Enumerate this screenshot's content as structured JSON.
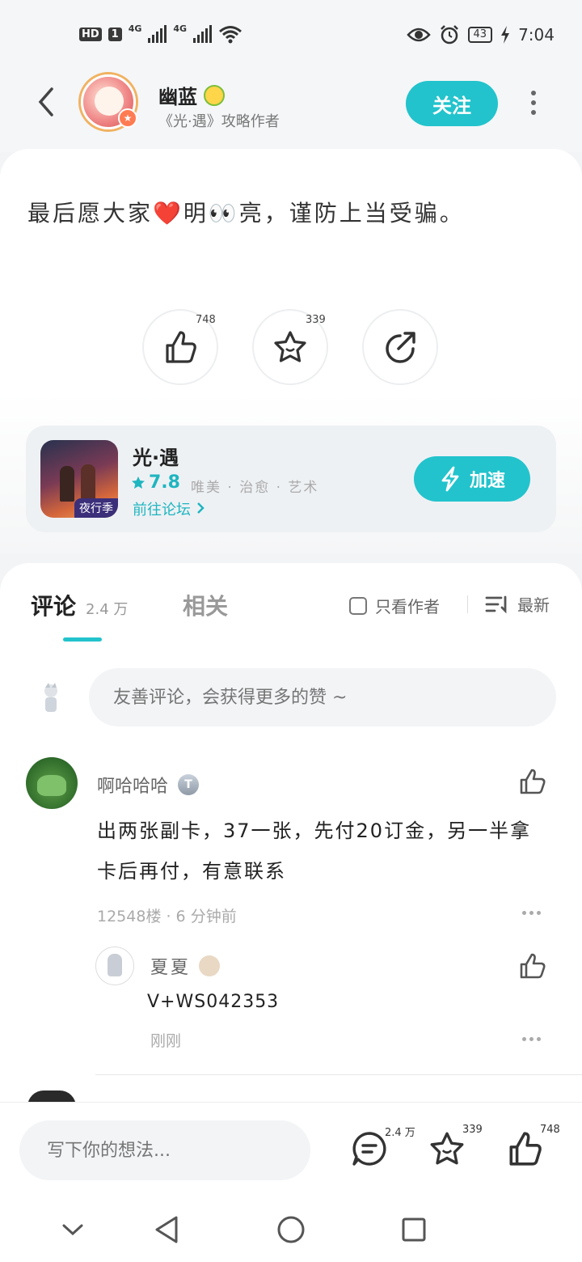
{
  "status_bar": {
    "hd": "HD",
    "sim": "1",
    "net1": "4G",
    "net2": "4G",
    "battery": "43",
    "time": "7:04"
  },
  "header": {
    "author_name": "幽蓝",
    "author_subtitle": "《光·遇》攻略作者",
    "follow_label": "关注"
  },
  "post": {
    "text": "最后愿大家❤️明👀亮，谨防上当受骗。",
    "like_count": "748",
    "favorite_count": "339"
  },
  "game_card": {
    "name": "光·遇",
    "rating": "7.8",
    "tags": "唯美 · 治愈 · 艺术",
    "icon_tag": "夜行季",
    "forum_link": "前往论坛",
    "boost_label": "加速"
  },
  "comments": {
    "tab_label": "评论",
    "tab_count": "2.4 万",
    "related_label": "相关",
    "author_only_label": "只看作者",
    "sort_label": "最新",
    "input_placeholder": "友善评论，会获得更多的赞 ~",
    "items": [
      {
        "user": "啊哈哈哈",
        "level_badge": "T",
        "text": "出两张副卡，37一张，先付20订金，另一半拿卡后再付，有意联系",
        "meta": "12548楼 · 6 分钟前",
        "reply": {
          "user": "夏夏",
          "text": "V+WS042353",
          "time": "刚刚"
        }
      }
    ]
  },
  "bottom_bar": {
    "input_placeholder": "写下你的想法...",
    "comment_count": "2.4 万",
    "favorite_count": "339",
    "like_count": "748"
  },
  "icons": {
    "back": "chevron-left-icon",
    "more": "more-vertical-icon",
    "like": "thumbs-up-icon",
    "favorite": "star-icon",
    "share": "share-icon",
    "boost": "lightning-icon",
    "sort": "sort-icon",
    "comment": "comment-icon"
  },
  "colors": {
    "accent": "#22c3cc",
    "accent_text": "#1fb5c0"
  }
}
